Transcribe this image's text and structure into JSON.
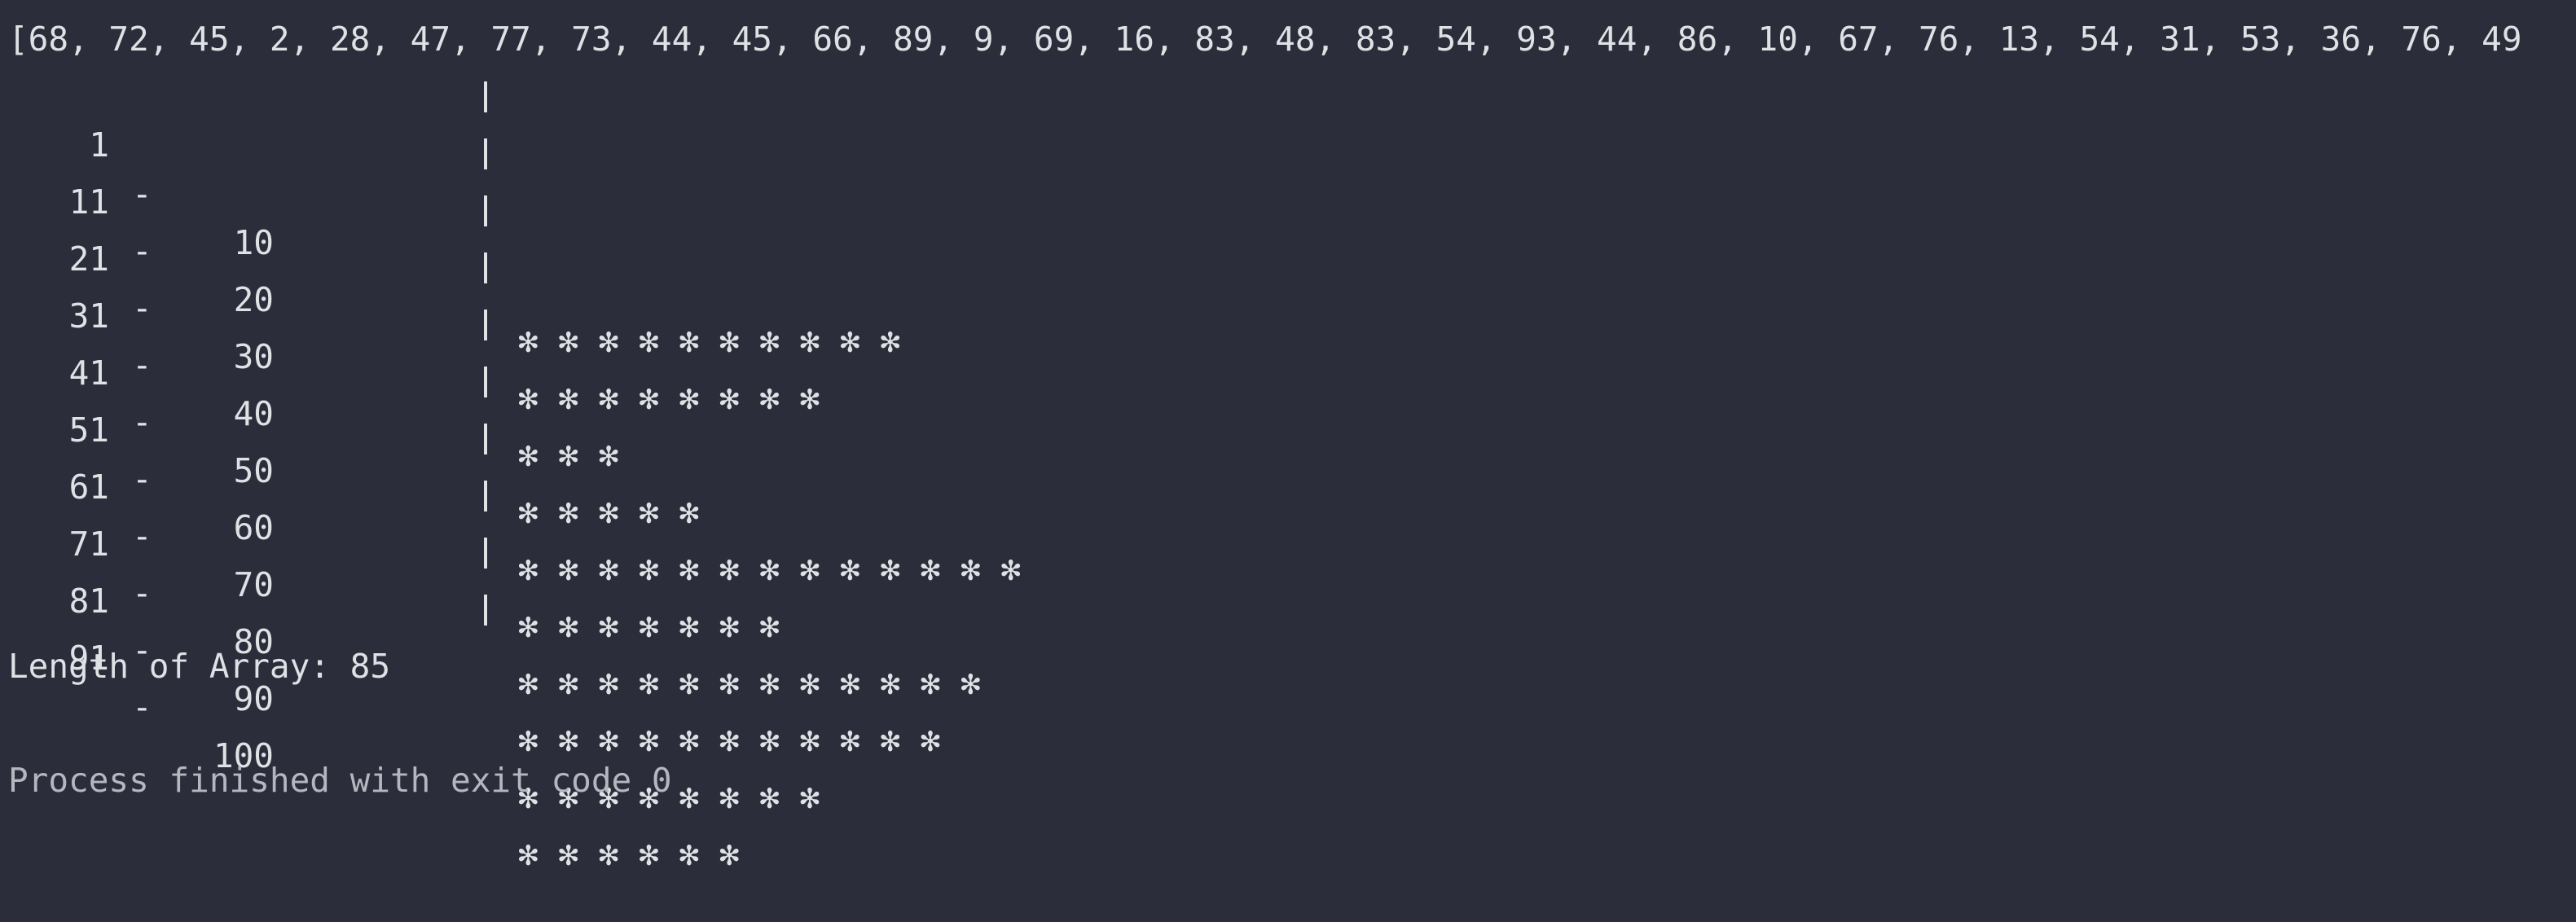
{
  "console": {
    "array_line": "[68, 72, 45, 2, 28, 47, 77, 73, 44, 45, 66, 89, 9, 69, 16, 83, 48, 83, 54, 93, 44, 86, 10, 67, 76, 13, 54, 31, 53, 36, 76, 49",
    "histogram": [
      {
        "from": "1",
        "dash": "-",
        "to": "10",
        "stars": "✻ ✻ ✻ ✻ ✻ ✻ ✻ ✻ ✻ ✻",
        "count": 10
      },
      {
        "from": "11",
        "dash": "-",
        "to": "20",
        "stars": "✻ ✻ ✻ ✻ ✻ ✻ ✻ ✻",
        "count": 8
      },
      {
        "from": "21",
        "dash": "-",
        "to": "30",
        "stars": "✻ ✻ ✻",
        "count": 3
      },
      {
        "from": "31",
        "dash": "-",
        "to": "40",
        "stars": "✻ ✻ ✻ ✻ ✻",
        "count": 5
      },
      {
        "from": "41",
        "dash": "-",
        "to": "50",
        "stars": "✻ ✻ ✻ ✻ ✻ ✻ ✻ ✻ ✻ ✻ ✻ ✻ ✻",
        "count": 13
      },
      {
        "from": "51",
        "dash": "-",
        "to": "60",
        "stars": "✻ ✻ ✻ ✻ ✻ ✻ ✻",
        "count": 7
      },
      {
        "from": "61",
        "dash": "-",
        "to": "70",
        "stars": "✻ ✻ ✻ ✻ ✻ ✻ ✻ ✻ ✻ ✻ ✻ ✻",
        "count": 12
      },
      {
        "from": "71",
        "dash": "-",
        "to": "80",
        "stars": "✻ ✻ ✻ ✻ ✻ ✻ ✻ ✻ ✻ ✻ ✻",
        "count": 11
      },
      {
        "from": "81",
        "dash": "-",
        "to": "90",
        "stars": "✻ ✻ ✻ ✻ ✻ ✻ ✻ ✻",
        "count": 8
      },
      {
        "from": "91",
        "dash": "-",
        "to": "100",
        "stars": "✻ ✻ ✻ ✻ ✻ ✻",
        "count": 6
      }
    ],
    "length_line": "Length of Array: 85",
    "exit_line": "Process finished with exit code 0"
  },
  "colors": {
    "background": "#2b2d3a",
    "text": "#dfe1e5",
    "muted_text": "#b4b7bf"
  }
}
